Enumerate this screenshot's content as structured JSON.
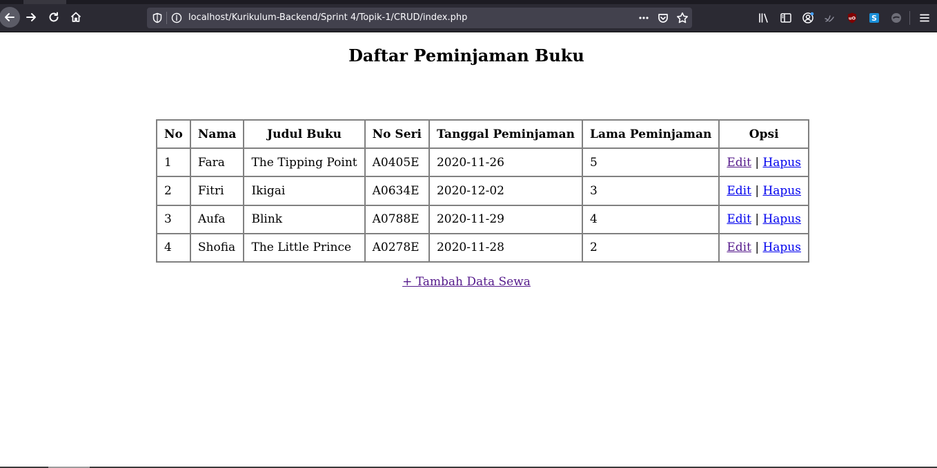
{
  "browser": {
    "url": "localhost/Kurikulum-Backend/Sprint 4/Topik-1/CRUD/index.php",
    "icons": [
      "back-arrow-icon",
      "forward-arrow-icon",
      "reload-icon",
      "home-icon",
      "shield-icon",
      "info-icon",
      "more-horizontal-icon",
      "pocket-icon",
      "star-icon",
      "library-icon",
      "sidebar-icon",
      "account-icon",
      "extension-icon",
      "ublock-icon",
      "extension-s-icon",
      "extension-icon",
      "hamburger-menu-icon"
    ]
  },
  "page": {
    "title": "Daftar Peminjaman Buku",
    "table": {
      "headers": [
        "No",
        "Nama",
        "Judul Buku",
        "No Seri",
        "Tanggal Peminjaman",
        "Lama Peminjaman",
        "Opsi"
      ],
      "rows": [
        {
          "no": "1",
          "nama": "Fara",
          "judul": "The Tipping Point",
          "seri": "A0405E",
          "tanggal": "2020-11-26",
          "lama": "5",
          "edit": "Edit",
          "sep": "|",
          "hapus": "Hapus"
        },
        {
          "no": "2",
          "nama": "Fitri",
          "judul": "Ikigai",
          "seri": "A0634E",
          "tanggal": "2020-12-02",
          "lama": "3",
          "edit": "Edit",
          "sep": "|",
          "hapus": "Hapus"
        },
        {
          "no": "3",
          "nama": "Aufa",
          "judul": "Blink",
          "seri": "A0788E",
          "tanggal": "2020-11-29",
          "lama": "4",
          "edit": "Edit",
          "sep": "|",
          "hapus": "Hapus"
        },
        {
          "no": "4",
          "nama": "Shofia",
          "judul": "The Little Prince",
          "seri": "A0278E",
          "tanggal": "2020-11-28",
          "lama": "2",
          "edit": "Edit",
          "sep": "|",
          "hapus": "Hapus"
        }
      ]
    },
    "add_link": "+ Tambah Data Sewa"
  },
  "colors": {
    "link": "#0000ee",
    "visited_link": "#551a8b",
    "toolbar": "#2b2a33",
    "urlbar": "#42414d"
  }
}
